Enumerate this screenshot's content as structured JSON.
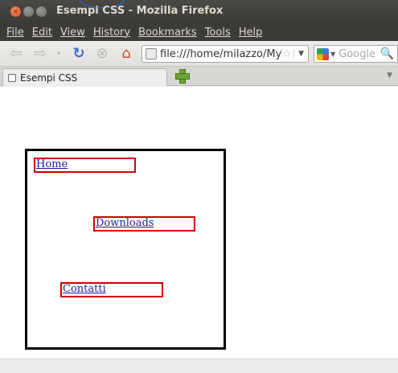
{
  "window": {
    "title": "Esempi CSS - Mozilla Firefox"
  },
  "menu": [
    "File",
    "Edit",
    "View",
    "History",
    "Bookmarks",
    "Tools",
    "Help"
  ],
  "nav": {
    "url": "file:///home/milazzo/MyTe",
    "search_placeholder": "Google"
  },
  "tab": {
    "title": "Esempi CSS"
  },
  "page": {
    "links": [
      "Home",
      "Downloads",
      "Contatti"
    ]
  }
}
